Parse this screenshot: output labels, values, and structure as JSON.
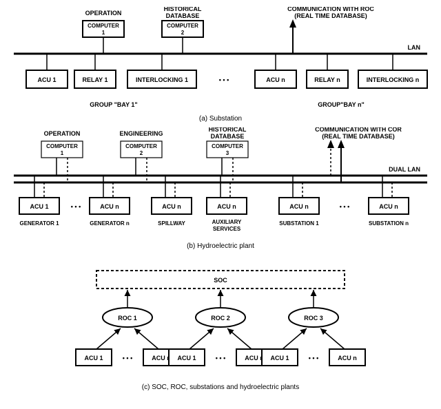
{
  "a": {
    "top": {
      "operation": "OPERATION",
      "historical": "HISTORICAL DATABASE",
      "comm": "COMMUNICATION WITH ROC (REAL TIME DATABASE)",
      "comp1_l1": "COMPUTER",
      "comp1_l2": "1",
      "comp2_l1": "COMPUTER",
      "comp2_l2": "2"
    },
    "lan": "LAN",
    "row": {
      "acu1": "ACU 1",
      "relay1": "RELAY 1",
      "inter1": "INTERLOCKING 1",
      "dots": "• • •",
      "acun": "ACU n",
      "relayn": "RELAY n",
      "intern": "INTERLOCKING n"
    },
    "bay1": "GROUP \"BAY 1\"",
    "bayn": "GROUP\"BAY n\"",
    "caption": "(a) Substation"
  },
  "b": {
    "top": {
      "operation": "OPERATION",
      "engineering": "ENGINEERING",
      "historical": "HISTORICAL DATABASE",
      "comm": "COMMUNICATION WITH COR (REAL TIME DATABASE)",
      "c1a": "COMPUTER",
      "c1b": "1",
      "c2a": "COMPUTER",
      "c2b": "2",
      "c3a": "COMPUTER",
      "c3b": "3"
    },
    "lan": "DUAL LAN",
    "row": {
      "acu1": "ACU 1",
      "acun": "ACU n",
      "acun2": "ACU n",
      "acun3": "ACU n",
      "acun4": "ACU n",
      "acun5": "ACU n",
      "gen1": "GENERATOR 1",
      "genn": "GENERATOR n",
      "spill": "SPILLWAY",
      "aux1": "AUXILIARY",
      "aux2": "SERVICES",
      "sub1": "SUBSTATION 1",
      "subn": "SUBSTATION n",
      "dots": "• • •"
    },
    "caption": "(b) Hydroelectric plant"
  },
  "c": {
    "soc": "SOC",
    "roc1": "ROC 1",
    "roc2": "ROC 2",
    "roc3": "ROC 3",
    "acu1": "ACU 1",
    "acun": "ACU n",
    "dots": "• • •",
    "caption": "(c) SOC, ROC, substations and hydroelectric plants"
  }
}
